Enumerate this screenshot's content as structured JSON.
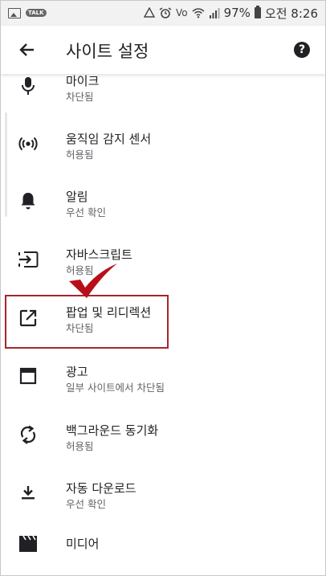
{
  "status_bar": {
    "signal_label": "Vo",
    "battery": "97%",
    "time": "오전 8:26"
  },
  "app_bar": {
    "title": "사이트 설정",
    "back_icon": "arrow-back-icon",
    "help_icon": "help-icon"
  },
  "items": [
    {
      "label": "마이크",
      "sub": "차단됨",
      "icon": "microphone-icon"
    },
    {
      "label": "움직임 감지 센서",
      "sub": "허용됨",
      "icon": "motion-sensor-icon"
    },
    {
      "label": "알림",
      "sub": "우선 확인",
      "icon": "bell-icon"
    },
    {
      "label": "자바스크립트",
      "sub": "허용됨",
      "icon": "javascript-icon"
    },
    {
      "label": "팝업 및 리디렉션",
      "sub": "차단됨",
      "icon": "open-in-new-icon"
    },
    {
      "label": "광고",
      "sub": "일부 사이트에서 차단됨",
      "icon": "ads-window-icon"
    },
    {
      "label": "백그라운드 동기화",
      "sub": "허용됨",
      "icon": "sync-icon"
    },
    {
      "label": "자동 다운로드",
      "sub": "우선 확인",
      "icon": "download-icon"
    },
    {
      "label": "미디어",
      "icon": "media-clapper-icon"
    }
  ],
  "colors": {
    "highlight": "#a8262e",
    "check": "#b8101a",
    "text": "#202124",
    "subtext": "#5f6368"
  }
}
